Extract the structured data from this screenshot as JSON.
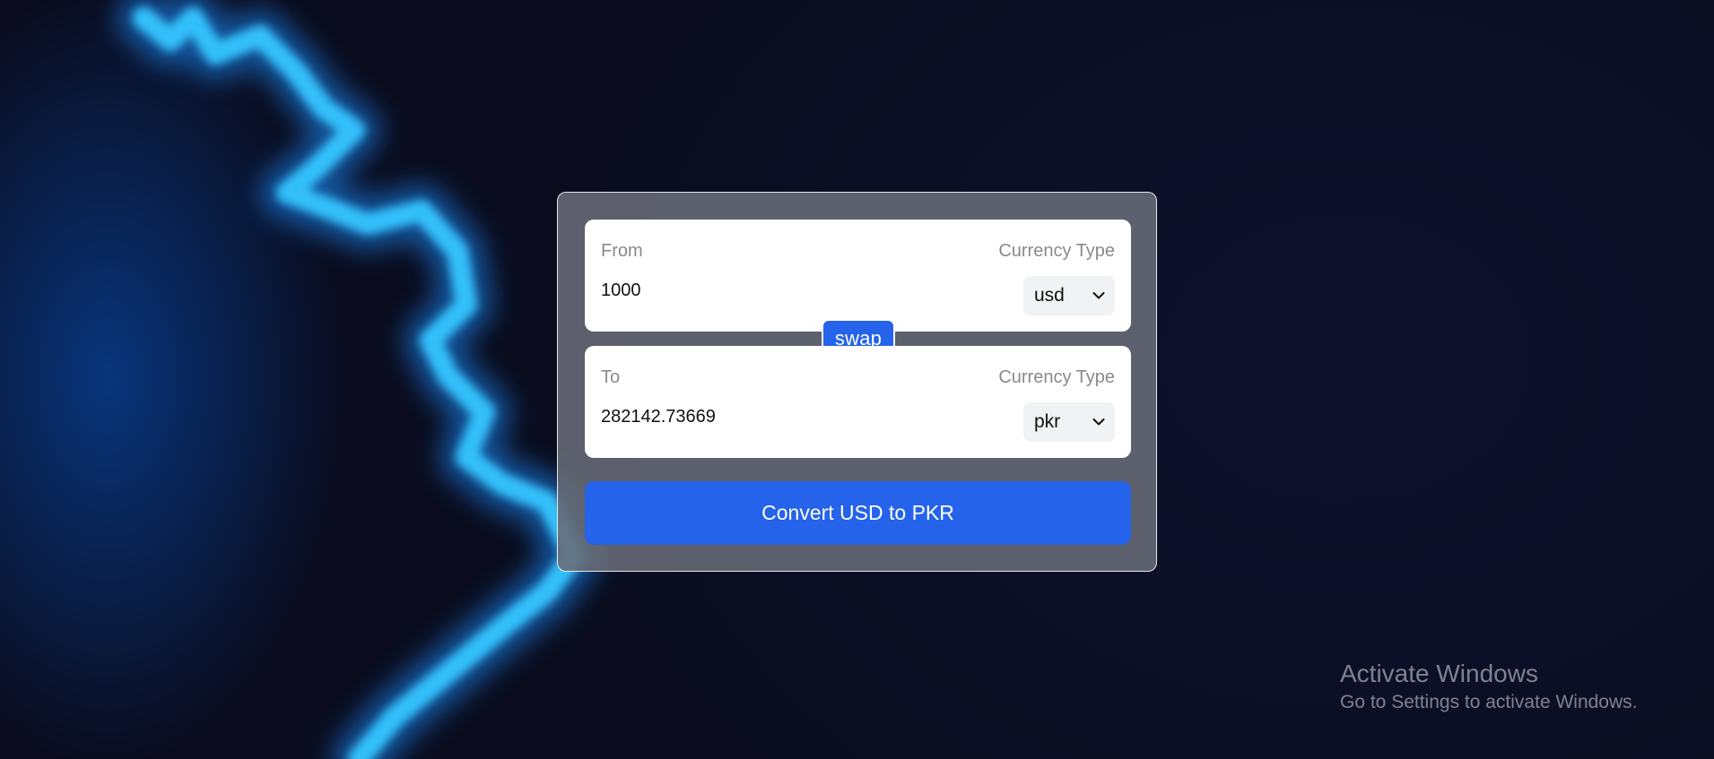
{
  "converter": {
    "from": {
      "label": "From",
      "currency_type_label": "Currency Type",
      "amount": "1000",
      "currency": "usd"
    },
    "swap_label": "swap",
    "to": {
      "label": "To",
      "currency_type_label": "Currency Type",
      "amount": "282142.73669",
      "currency": "pkr"
    },
    "convert_label": "Convert USD to PKR"
  },
  "os_watermark": {
    "title": "Activate Windows",
    "subtitle": "Go to Settings to activate Windows."
  },
  "colors": {
    "accent": "#2563eb",
    "panel": "#ffffff",
    "card": "#696c78"
  },
  "icons": {
    "select_arrow": "chevron-down-icon"
  }
}
